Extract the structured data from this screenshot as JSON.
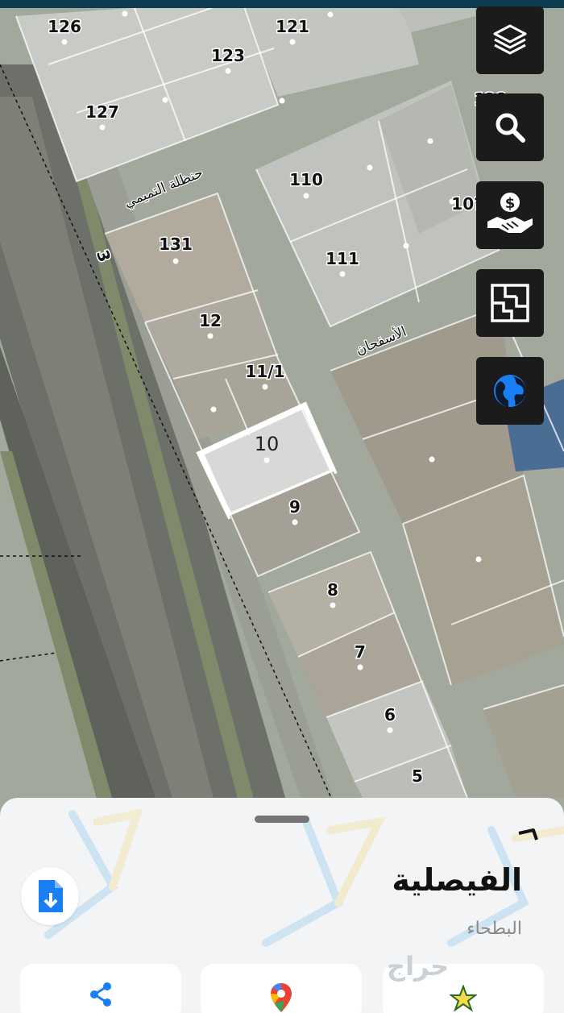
{
  "map": {
    "plots": [
      "126",
      "121",
      "123",
      "127",
      "110",
      "1?6",
      "10?",
      "131",
      "111",
      "12",
      "11/1",
      "10",
      "9",
      "8",
      "7",
      "6",
      "5"
    ],
    "streets": [
      "حنظلة التميمي",
      "الأسفحان",
      "3"
    ],
    "buttons": [
      "layers-icon",
      "search-icon",
      "handshake-dollar-icon",
      "floor-plan-icon",
      "globe-icon"
    ],
    "globe_color": "#1a7ff5"
  },
  "sheet": {
    "title": "الفيصلية",
    "subtitle": "البطحاء",
    "watermark": "حراج"
  },
  "actions": [
    {
      "icon": "share-icon"
    },
    {
      "icon": "google-maps-pin-icon"
    },
    {
      "icon": "star-icon"
    }
  ]
}
